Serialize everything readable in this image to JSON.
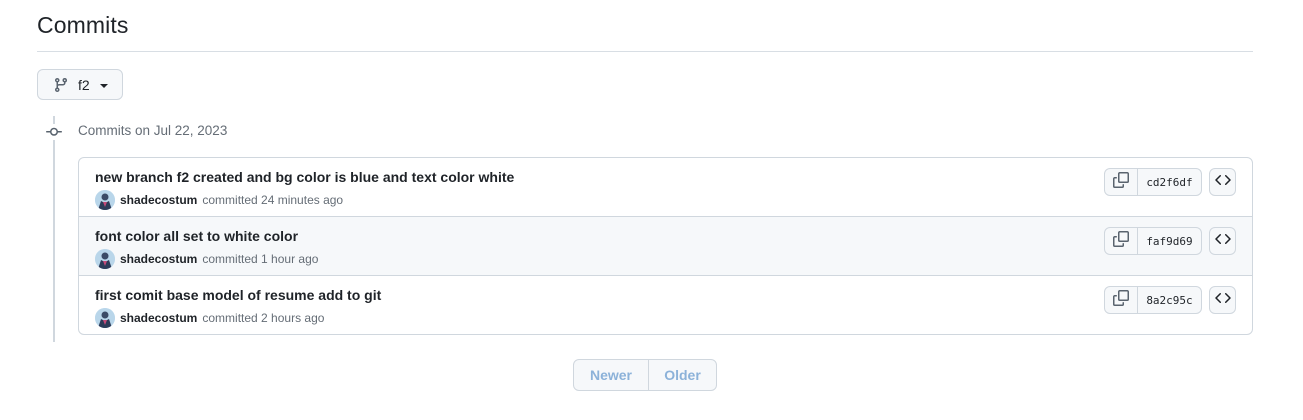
{
  "header": {
    "title": "Commits"
  },
  "branch": {
    "name": "f2",
    "icon": "git-branch-icon"
  },
  "timeline": {
    "date_label": "Commits on Jul 22, 2023"
  },
  "commits": [
    {
      "message": "new branch f2 created and bg color is blue and text color white",
      "author": "shadecostum",
      "time_text": "committed 24 minutes ago",
      "sha": "cd2f6df"
    },
    {
      "message": "font color all set to white color",
      "author": "shadecostum",
      "time_text": "committed 1 hour ago",
      "sha": "faf9d69"
    },
    {
      "message": "first comit base model of resume add to git",
      "author": "shadecostum",
      "time_text": "committed 2 hours ago",
      "sha": "8a2c95c"
    }
  ],
  "pagination": {
    "newer_label": "Newer",
    "older_label": "Older"
  },
  "colors": {
    "border": "#d0d7de",
    "muted_text": "#656d76",
    "disabled_link": "#8cb2d9",
    "button_bg": "#f6f8fa"
  }
}
